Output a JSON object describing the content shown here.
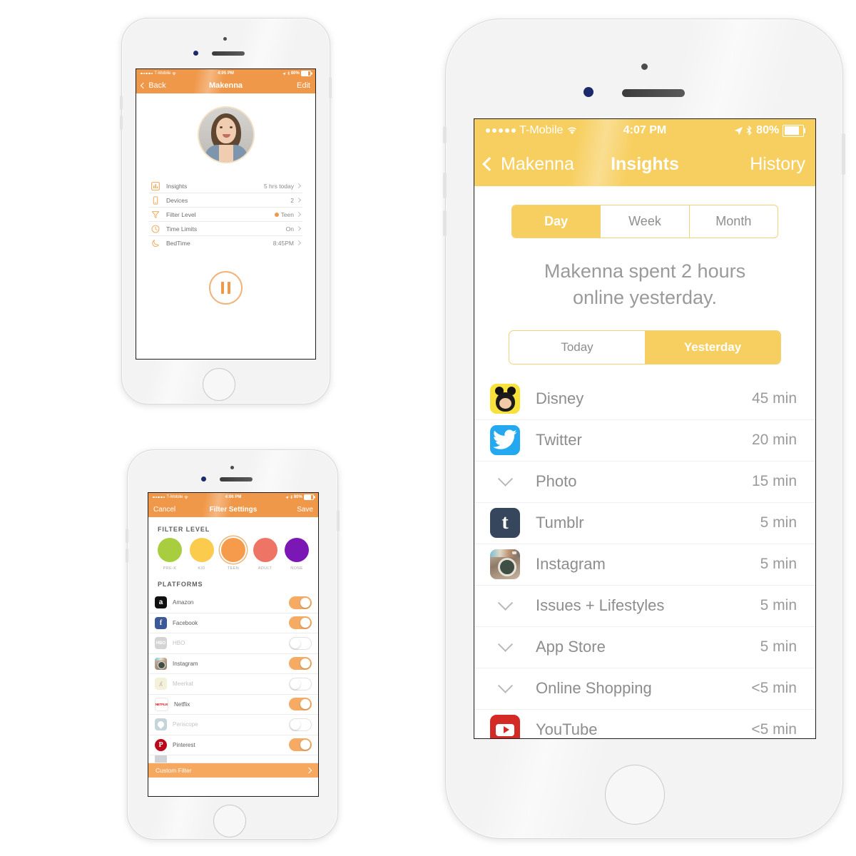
{
  "profile_phone": {
    "status_bar": {
      "carrier": "T-Mobile",
      "time": "4:05 PM",
      "battery_pct": "80%"
    },
    "nav": {
      "back_label": "Back",
      "title": "Makenna",
      "right_label": "Edit"
    },
    "avatar_alt": "Makenna profile photo",
    "menu": [
      {
        "icon": "insights-chart-icon",
        "label": "Insights",
        "value": "5 hrs today"
      },
      {
        "icon": "devices-phone-icon",
        "label": "Devices",
        "value": "2"
      },
      {
        "icon": "filter-funnel-icon",
        "label": "Filter Level",
        "value": "Teen",
        "dot_color": "#f0984a"
      },
      {
        "icon": "clock-icon",
        "label": "Time Limits",
        "value": "On"
      },
      {
        "icon": "moon-icon",
        "label": "BedTime",
        "value": "8:45PM"
      }
    ],
    "pause_button_label": "Pause internet"
  },
  "filter_phone": {
    "status_bar": {
      "carrier": "T-Mobile",
      "time": "4:06 PM",
      "battery_pct": "80%"
    },
    "nav": {
      "left_label": "Cancel",
      "title": "Filter Settings",
      "right_label": "Save"
    },
    "filter_level_heading": "FILTER LEVEL",
    "levels": [
      {
        "label": "PRE-K",
        "color": "#a8ce3f",
        "selected": false
      },
      {
        "label": "KID",
        "color": "#fbcb4e",
        "selected": false
      },
      {
        "label": "TEEN",
        "color": "#f59b4b",
        "selected": true
      },
      {
        "label": "ADULT",
        "color": "#ee7566",
        "selected": false
      },
      {
        "label": "NONE",
        "color": "#7b18b5",
        "selected": false
      }
    ],
    "platforms_heading": "PLATFORMS",
    "platforms": [
      {
        "name": "Amazon",
        "icon": "amazon-icon",
        "on": true
      },
      {
        "name": "Facebook",
        "icon": "facebook-icon",
        "on": true
      },
      {
        "name": "HBO",
        "icon": "hbo-icon",
        "on": false
      },
      {
        "name": "Instagram",
        "icon": "instagram-icon",
        "on": true
      },
      {
        "name": "Meerkat",
        "icon": "meerkat-icon",
        "on": false
      },
      {
        "name": "Netflix",
        "icon": "netflix-icon",
        "on": true
      },
      {
        "name": "Periscope",
        "icon": "periscope-icon",
        "on": false
      },
      {
        "name": "Pinterest",
        "icon": "pinterest-icon",
        "on": true
      }
    ],
    "custom_filter_label": "Custom Filter"
  },
  "insights_phone": {
    "status_bar": {
      "carrier": "T-Mobile",
      "time": "4:07 PM",
      "battery_pct": "80%"
    },
    "nav": {
      "back_label": "Makenna",
      "title": "Insights",
      "right_label": "History"
    },
    "period_tabs": [
      {
        "label": "Day",
        "selected": true
      },
      {
        "label": "Week",
        "selected": false
      },
      {
        "label": "Month",
        "selected": false
      }
    ],
    "headline_line1": "Makenna spent 2 hours",
    "headline_line2": "online yesterday.",
    "day_tabs": [
      {
        "label": "Today",
        "selected": false
      },
      {
        "label": "Yesterday",
        "selected": true
      }
    ],
    "apps": [
      {
        "name": "Disney",
        "time": "45 min",
        "icon": "disney-icon",
        "has_icon": true
      },
      {
        "name": "Twitter",
        "time": "20 min",
        "icon": "twitter-icon",
        "has_icon": true
      },
      {
        "name": "Photo",
        "time": "15 min",
        "icon": "chevron-down-icon",
        "has_icon": false
      },
      {
        "name": "Tumblr",
        "time": "5 min",
        "icon": "tumblr-icon",
        "has_icon": true
      },
      {
        "name": "Instagram",
        "time": "5 min",
        "icon": "instagram-icon",
        "has_icon": true
      },
      {
        "name": "Issues + Lifestyles",
        "time": "5 min",
        "icon": "chevron-down-icon",
        "has_icon": false
      },
      {
        "name": "App Store",
        "time": "5 min",
        "icon": "chevron-down-icon",
        "has_icon": false
      },
      {
        "name": "Online Shopping",
        "time": "<5 min",
        "icon": "chevron-down-icon",
        "has_icon": false
      },
      {
        "name": "YouTube",
        "time": "<5 min",
        "icon": "youtube-icon",
        "has_icon": true
      }
    ]
  },
  "theme": {
    "yellow": "#f7cf61",
    "orange": "#f0984a",
    "grey_text": "#8d8d8d"
  }
}
